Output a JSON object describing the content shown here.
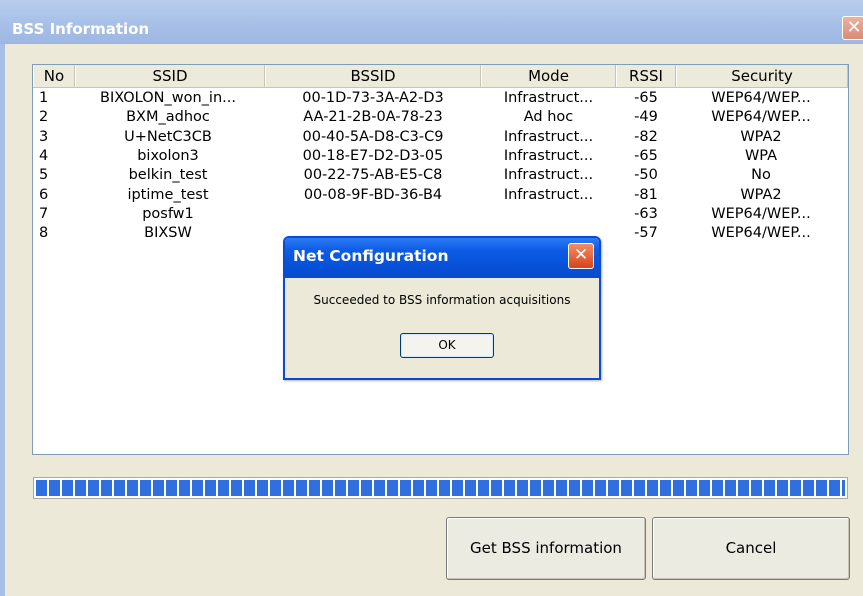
{
  "window": {
    "title": "BSS Information",
    "close_glyph": "✕"
  },
  "table": {
    "columns": [
      "No",
      "SSID",
      "BSSID",
      "Mode",
      "RSSI",
      "Security"
    ],
    "rows": [
      {
        "no": "1",
        "ssid": "BIXOLON_won_in...",
        "bssid": "00-1D-73-3A-A2-D3",
        "mode": "Infrastruct...",
        "rssi": "-65",
        "security": "WEP64/WEP..."
      },
      {
        "no": "2",
        "ssid": "BXM_adhoc",
        "bssid": "AA-21-2B-0A-78-23",
        "mode": "Ad hoc",
        "rssi": "-49",
        "security": "WEP64/WEP..."
      },
      {
        "no": "3",
        "ssid": "U+NetC3CB",
        "bssid": "00-40-5A-D8-C3-C9",
        "mode": "Infrastruct...",
        "rssi": "-82",
        "security": "WPA2"
      },
      {
        "no": "4",
        "ssid": "bixolon3",
        "bssid": "00-18-E7-D2-D3-05",
        "mode": "Infrastruct...",
        "rssi": "-65",
        "security": "WPA"
      },
      {
        "no": "5",
        "ssid": "belkin_test",
        "bssid": "00-22-75-AB-E5-C8",
        "mode": "Infrastruct...",
        "rssi": "-50",
        "security": "No"
      },
      {
        "no": "6",
        "ssid": "iptime_test",
        "bssid": "00-08-9F-BD-36-B4",
        "mode": "Infrastruct...",
        "rssi": "-81",
        "security": "WPA2"
      },
      {
        "no": "7",
        "ssid": "posfw1",
        "bssid": "",
        "mode": "",
        "rssi": "-63",
        "security": "WEP64/WEP..."
      },
      {
        "no": "8",
        "ssid": "BIXSW",
        "bssid": "",
        "mode": "",
        "rssi": "-57",
        "security": "WEP64/WEP..."
      }
    ]
  },
  "progress": {
    "fraction": 1.0,
    "color": "#2f6fe0"
  },
  "buttons": {
    "get_bss": "Get BSS information",
    "cancel": "Cancel"
  },
  "dialog": {
    "title": "Net Configuration",
    "message": "Succeeded to BSS information acquisitions",
    "ok_label": "OK",
    "close_glyph": "✕"
  },
  "colors": {
    "dialog_title": "#0651d8",
    "window_title": "#a9c1e8",
    "close_red": "#d9431a"
  }
}
